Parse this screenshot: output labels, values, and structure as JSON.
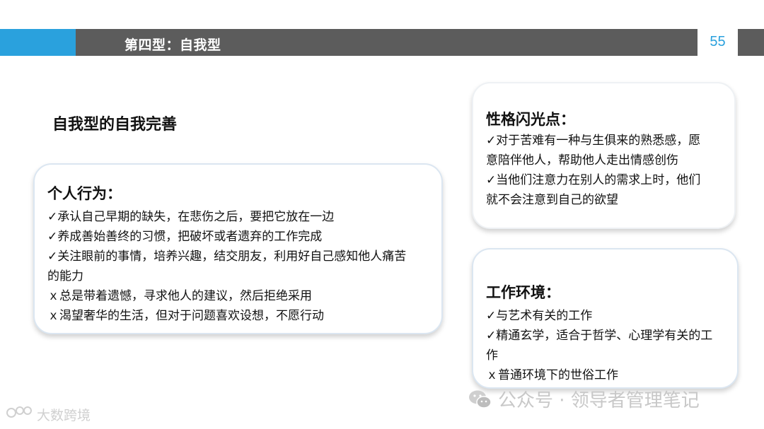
{
  "header": {
    "title": "第四型：自我型",
    "page_number": "55",
    "accent_color": "#2aa1dd",
    "bar_color": "#5c5c5c"
  },
  "section_title": "自我型的自我完善",
  "behavior": {
    "heading": "个人行为：",
    "lines": [
      "✓承认自己早期的缺失，在悲伤之后，要把它放在一边",
      "✓养成善始善终的习惯，把破坏或者遗弃的工作完成",
      "✓关注眼前的事情，培养兴趣，结交朋友，利用好自己感知他人痛苦",
      "的能力",
      "ｘ总是带着遗憾，寻求他人的建议，然后拒绝采用",
      "ｘ渴望奢华的生活，但对于问题喜欢设想，不愿行动"
    ]
  },
  "flash": {
    "heading": "性格闪光点：",
    "lines": [
      "✓对于苦难有一种与生俱来的熟悉感，愿",
      "意陪伴他人，帮助他人走出情感创伤",
      "✓当他们注意力在别人的需求上时，他们",
      "就不会注意到自己的欲望"
    ]
  },
  "environment": {
    "heading": "工作环境：",
    "lines": [
      "✓与艺术有关的工作",
      "✓精通玄学，适合于哲学、心理学有关的工",
      "作",
      "ｘ普通环境下的世俗工作"
    ]
  },
  "watermark": {
    "text": "公众号 · 领导者管理笔记",
    "icon": "wechat-icon"
  },
  "brand": {
    "text": "大数跨境"
  }
}
